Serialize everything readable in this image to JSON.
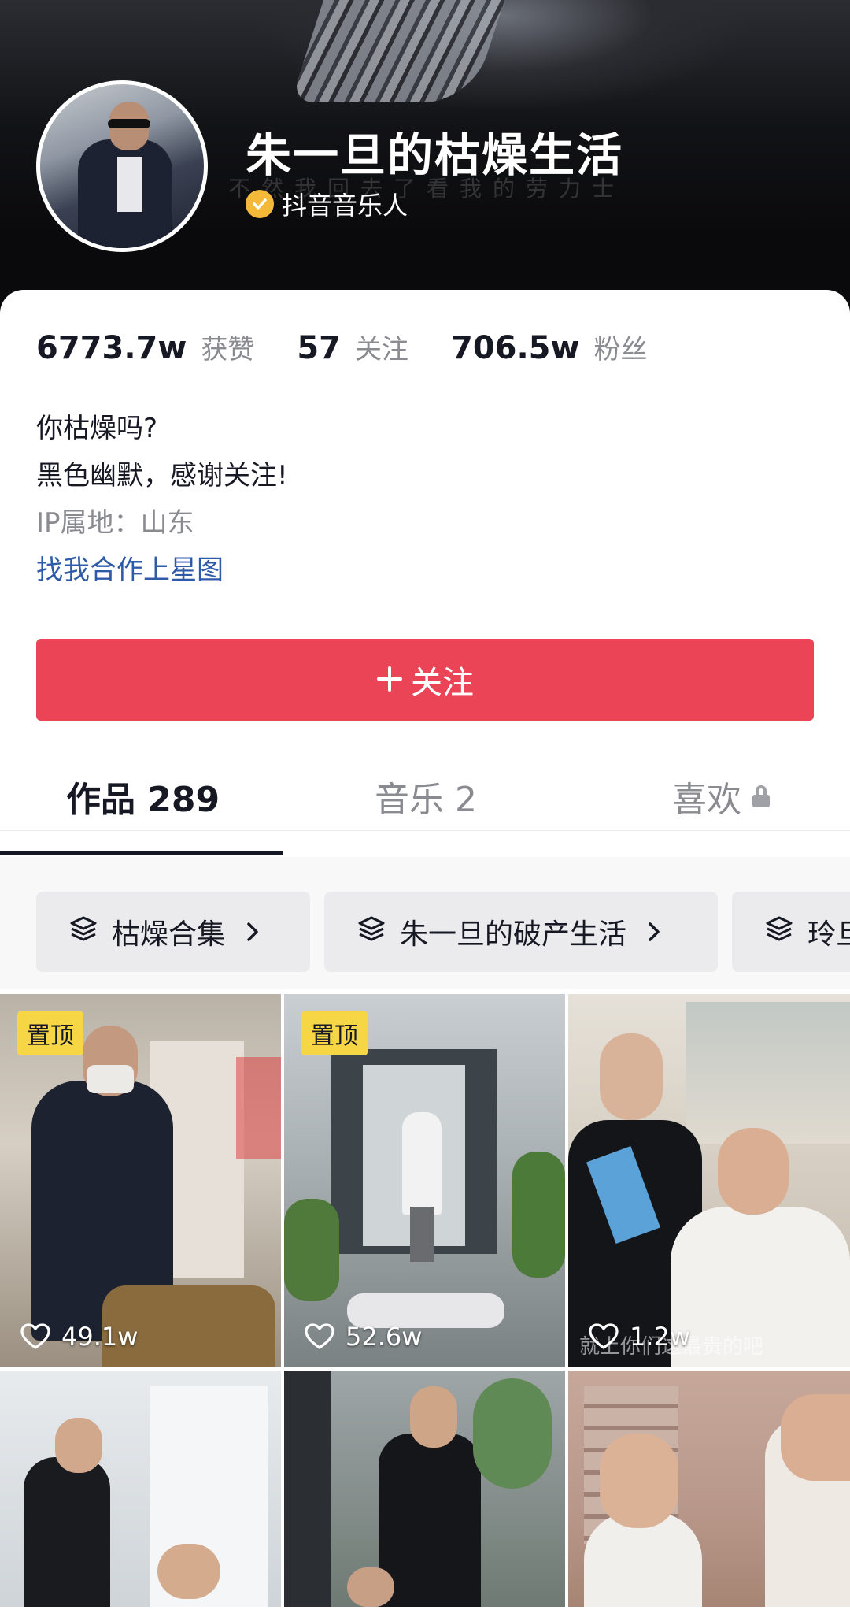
{
  "profile": {
    "name": "朱一旦的枯燥生活",
    "verify_label": "抖音音乐人",
    "bg_subtitle": "不然我回去了看我的劳力士"
  },
  "stats": [
    {
      "value": "6773.7w",
      "label": "获赞"
    },
    {
      "value": "57",
      "label": "关注"
    },
    {
      "value": "706.5w",
      "label": "粉丝"
    }
  ],
  "bio": {
    "line1": "你枯燥吗?",
    "line2": "黑色幽默，感谢关注!",
    "ip": "IP属地：山东",
    "cooperation_link": "找我合作上星图"
  },
  "follow_button": {
    "label": "关注",
    "icon": "plus-icon"
  },
  "tabs": [
    {
      "label": "作品 289",
      "active": true
    },
    {
      "label": "音乐 2",
      "active": false
    },
    {
      "label": "喜欢",
      "active": false,
      "icon": "lock-icon"
    }
  ],
  "collections": [
    {
      "label": "枯燥合集",
      "icon": "stack-icon"
    },
    {
      "label": "朱一旦的破产生活",
      "icon": "stack-icon"
    },
    {
      "label": "玲旦",
      "icon": "stack-icon"
    }
  ],
  "videos": [
    {
      "pinned": true,
      "pin_label": "置顶",
      "likes": "49.1w"
    },
    {
      "pinned": true,
      "pin_label": "置顶",
      "likes": "52.6w"
    },
    {
      "pinned": false,
      "likes": "1.2w",
      "caption": "就上你们这最贵的吧"
    },
    {
      "pinned": false
    },
    {
      "pinned": false
    },
    {
      "pinned": false
    }
  ],
  "colors": {
    "accent": "#ea4456",
    "link": "#2e5aa8",
    "pin_badge": "#f7d646",
    "verify_badge": "#f5b93a"
  }
}
